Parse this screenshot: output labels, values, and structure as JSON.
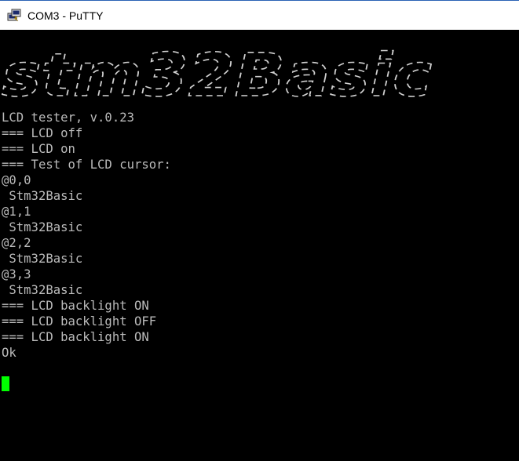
{
  "window": {
    "title": "COM3 - PuTTY",
    "icon": "putty-terminal-icon"
  },
  "terminal": {
    "background": "#000000",
    "foreground": "#bbbbbb",
    "cursor_color": "#00ff00",
    "banner_art": "stm32Basic",
    "lines": [
      "LCD tester, v.0.23",
      "=== LCD off",
      "=== LCD on",
      "=== Test of LCD cursor:",
      "@0,0",
      " Stm32Basic",
      "@1,1",
      " Stm32Basic",
      "@2,2",
      " Stm32Basic",
      "@3,3",
      " Stm32Basic",
      "=== LCD backlight ON",
      "=== LCD backlight OFF",
      "=== LCD backlight ON",
      "Ok"
    ]
  }
}
